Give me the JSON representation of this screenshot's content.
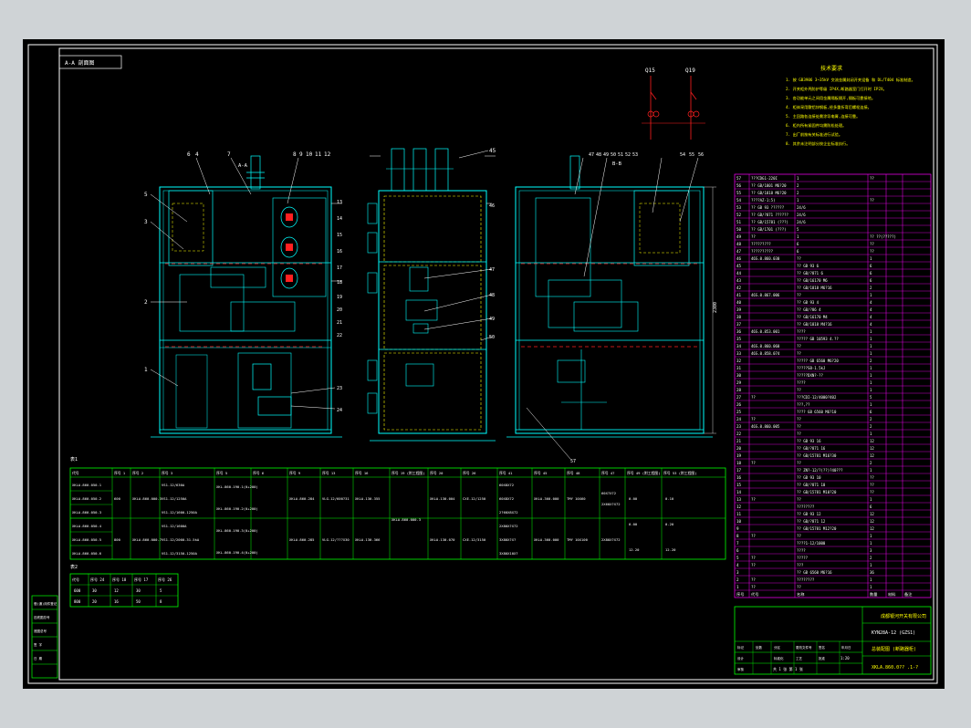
{
  "title_tag": "A-A 剖面图",
  "section_labels": {
    "a": "A-A",
    "b": "B-B"
  },
  "callouts": {
    "left_top": [
      "6",
      "4",
      "7",
      "8",
      "9",
      "10",
      "11",
      "12"
    ],
    "left_side": [
      "5",
      "3",
      "2",
      "1"
    ],
    "left_right": [
      "13",
      "14",
      "15",
      "16",
      "17",
      "18",
      "19",
      "20",
      "21",
      "22"
    ],
    "left_bottom": [
      "23",
      "24"
    ],
    "middle_top": "45",
    "middle_right": [
      "46",
      "47",
      "48",
      "49",
      "50"
    ],
    "right_top": [
      "47",
      "48",
      "49",
      "50",
      "51",
      "52",
      "53",
      "54",
      "55",
      "56"
    ],
    "right_bottom": "57",
    "right_dim": "2300"
  },
  "circuit": {
    "labels": [
      "Q15",
      "Q19"
    ]
  },
  "notes": {
    "heading": "技术要求",
    "lines": [
      "1. 按 GB3906 3~35kV 交流金属封闭开关设备 和 DL/T404 标准制造。",
      "2. 开关柜外壳防护等级 IP4X,断路器室门打开时 IP2X。",
      "3. 各功能单元之间用金属隔板隔开,隔板可靠接地。",
      "4. 柜体采用敷铝锌钢板,经多重折弯后螺栓连接。",
      "5. 主回路各连接处需涂导电膏,连接可靠。",
      "6. 柜内所有紧固件均需防松处理。",
      "7. 出厂前按有关标准进行试验。",
      "8. 其余未注明部分按企业标准执行。"
    ]
  },
  "bom": {
    "rows": [
      [
        "57",
        "???CDG1-220I",
        "1",
        "??"
      ],
      [
        "56",
        "?? GB/1801 M6?20",
        "2",
        ""
      ],
      [
        "55",
        "?? GB/1818 M6?20",
        "2",
        ""
      ],
      [
        "54",
        "????AZ-1:5)",
        "1",
        "??"
      ],
      [
        "53",
        "?? GB 93 ??????",
        "24/6",
        ""
      ],
      [
        "52",
        "?? GB/?871 ??????",
        "24/6",
        ""
      ],
      [
        "51",
        "?? GB/15781 (???)",
        "24/6",
        ""
      ],
      [
        "50",
        "?? GB/1701 (???)",
        "5",
        ""
      ],
      [
        "49",
        "??",
        "1",
        "?? ??(?????)"
      ],
      [
        "48",
        "?????????",
        "6",
        "??"
      ],
      [
        "47",
        "??????????",
        "6",
        "??"
      ],
      [
        "46",
        "46S.0.860.030",
        "??",
        "1"
      ],
      [
        "45",
        "",
        "?? GB 93 6",
        "6"
      ],
      [
        "44",
        "",
        "?? GB/?871 6",
        "6"
      ],
      [
        "43",
        "",
        "?? GB/16170 M6",
        "6"
      ],
      [
        "42",
        "",
        "?? GB/1818 M6?16",
        "2"
      ],
      [
        "41",
        "46S.0.867.006",
        "??",
        "1"
      ],
      [
        "40",
        "",
        "?? GB 93 4",
        "4"
      ],
      [
        "39",
        "",
        "?? GB/?86 4",
        "4"
      ],
      [
        "38",
        "",
        "?? GB/16170 M4",
        "4"
      ],
      [
        "37",
        "",
        "?? GB/1818 M4?16",
        "4"
      ],
      [
        "36",
        "46S.0.853.001",
        "????",
        "1"
      ],
      [
        "35",
        "",
        "????? GB 10593 4.??",
        "1"
      ],
      [
        "34",
        "46S.0.860.060",
        "??",
        "1"
      ],
      [
        "33",
        "46S.0.858.074",
        "??",
        "1"
      ],
      [
        "32",
        "",
        "????? GB 6560 M6?20",
        "2"
      ],
      [
        "31",
        "",
        "?????SB-1.5kJ",
        "1"
      ],
      [
        "30",
        "",
        "?????DXN?-??",
        "1"
      ],
      [
        "29",
        "",
        "????",
        "1"
      ],
      [
        "28",
        "",
        "??",
        "1"
      ],
      [
        "27",
        "??",
        "???CDI-12/4000?402",
        "5"
      ],
      [
        "26",
        "",
        "???,??",
        "1"
      ],
      [
        "25",
        "",
        "???? GB 6560 M6?10",
        "6"
      ],
      [
        "24",
        "??",
        "??",
        "2"
      ],
      [
        "23",
        "46S.0.860.005",
        "??",
        "2"
      ],
      [
        "22",
        "",
        "??",
        "1"
      ],
      [
        "21",
        "",
        "?? GB 93 16",
        "12"
      ],
      [
        "20",
        "",
        "?? GB/?871 16",
        "12"
      ],
      [
        "19",
        "",
        "?? GB/15781 M16?30",
        "12"
      ],
      [
        "18",
        "??",
        "??",
        "2"
      ],
      [
        "17",
        "",
        "?? ZN?-12/?(??)?40???",
        "1"
      ],
      [
        "16",
        "",
        "?? GB 93 10",
        "??"
      ],
      [
        "15",
        "",
        "?? GB/?871 10",
        "??"
      ],
      [
        "14",
        "",
        "?? GB/15781 M10?20",
        "??"
      ],
      [
        "13",
        "??",
        "??",
        "1"
      ],
      [
        "12",
        "",
        "????????",
        "6"
      ],
      [
        "11",
        "",
        "?? GB 93 12",
        "12"
      ],
      [
        "10",
        "",
        "?? GB/?871 12",
        "12"
      ],
      [
        "9",
        "",
        "?? GB/15781 M12?20",
        "12"
      ],
      [
        "8",
        "??",
        "??",
        "1"
      ],
      [
        "7",
        "",
        "????1-12/1000",
        "1"
      ],
      [
        "6",
        "",
        "????",
        "3"
      ],
      [
        "5",
        "??",
        "?????",
        "2"
      ],
      [
        "4",
        "??",
        "???",
        "1"
      ],
      [
        "3",
        "",
        "?? GB 6560 M6?16",
        "36"
      ],
      [
        "2",
        "??",
        "????????",
        "1"
      ],
      [
        "1",
        "??",
        "??",
        "1"
      ]
    ],
    "header": [
      "序号",
      "代号",
      "名称",
      "数量",
      "材料",
      "备注"
    ]
  },
  "title_block": {
    "company": "成都银河开关有限公司",
    "product": "KYN28A-12 (GZS1)",
    "drawing_name": "总装配图 (断路器柜)",
    "drawing_no": "XKLA.860.0?? .1-?",
    "scale": "1:20",
    "sheet": "共 1 张 第 1 张",
    "rows": [
      "标记",
      "处数",
      "分区",
      "更改文件号",
      "签名",
      "年月日",
      "设计",
      "标准化",
      "审核",
      "工艺",
      "批准"
    ]
  },
  "table1": {
    "label": "表1",
    "header": [
      "代号",
      "序号 1",
      "序号 2",
      "序号 3",
      "序号 5",
      "序号 6",
      "序号 9",
      "序号 13",
      "序号 16",
      "序号 19 (附工程图)",
      "序号 20",
      "序号 26",
      "序号 41",
      "序号 45",
      "序号 48",
      "序号 47",
      "序号 49 (附工程图)",
      "序号 53 (附工程图)"
    ],
    "codes": [
      "XKLA.860.050.1",
      "XKLA.860.050.2",
      "XKLA.860.050.3",
      "XKLA.860.050.4",
      "XKLA.860.050.5",
      "XKLA.860.050.6"
    ],
    "cells": {
      "s1a": "600",
      "s1b": "800",
      "s2a": "XKLA.860.000.3",
      "s2b": "XKLA.860.000.7",
      "s3": [
        "VS1-12/630A",
        "VS1-12/1250A",
        "VS1-12/1600-1250A",
        "VS1-12/1600A",
        "VS1-12/2000-31.5kA",
        "VS1-12/3150-1250A"
      ],
      "s5": [
        "XKL.860.190.1(0+200)",
        "XKL.860.190.2(0+200)",
        "XKL.860.190.3(0+200)",
        "XKL.860.190.4(0+200)"
      ],
      "s9a": "XKLA.860.284",
      "s9b": "XKLA.860.285",
      "s13a": "VLG-12/600?31",
      "s13b": "VLG-12/???X30",
      "s16a": "XKLA.130.355",
      "s16b": "XKLA.130.366",
      "s19": "XKLA.860.000.3",
      "s20a": "XKLA.130.004",
      "s20b": "XKLA.130.070",
      "s26a": "CXE-12/1250",
      "s26b": "CXE-12/3150",
      "s41": [
        "60X8X72",
        "60X8X72",
        "2?60X8X72",
        "2X80X?X72",
        "3X80X?X?",
        "3X80X10X?"
      ],
      "s45a": "XKLA.360.000",
      "s45b": "XKLA.360.000",
      "s48a": "TMY 10X60",
      "s48b": "TMY 10X100",
      "s47a": "60X?X72",
      "s47b": "2X60X?X72",
      "s47c": "2X80X?X72",
      "v1": [
        "0.00",
        "0.00",
        "12.20"
      ],
      "v2": [
        "0.10",
        "0.20",
        "12.20"
      ]
    }
  },
  "table2": {
    "label": "表2",
    "header": [
      "代号",
      "序号 24",
      "序号 18",
      "序号 17",
      "序号 26"
    ],
    "rows": [
      [
        "600",
        "30",
        "12",
        "30",
        "5"
      ],
      [
        "800",
        "20",
        "16",
        "50",
        "8"
      ]
    ]
  },
  "side_stamp": [
    "借(通)用件登记",
    "旧底图总号",
    "底图总号",
    "签 字",
    "日 期"
  ],
  "colors": {
    "background": "#000000",
    "frame": "#ffffff",
    "cabinet": "#00ffff",
    "table": "#00ff00",
    "bom": "#ff00ff",
    "notes": "#ffff00",
    "hidden": "#ffff00",
    "accent": "#ff2020"
  }
}
